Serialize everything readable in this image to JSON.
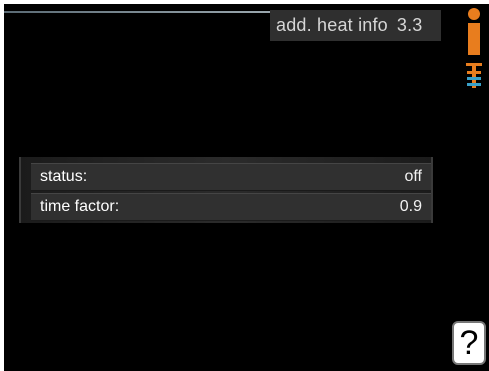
{
  "header": {
    "title": "add. heat info",
    "menu_number": "3.3"
  },
  "icons": {
    "info": "info-icon",
    "heating": "heating-tap-icon",
    "help": "help-icon"
  },
  "rows": [
    {
      "label": "status:",
      "value": "off"
    },
    {
      "label": "time factor:",
      "value": "0.9"
    }
  ],
  "help_label": "?",
  "colors": {
    "background": "#000000",
    "accent": "#e87d1e",
    "row_background": "#303030",
    "text": "#ffffff"
  }
}
